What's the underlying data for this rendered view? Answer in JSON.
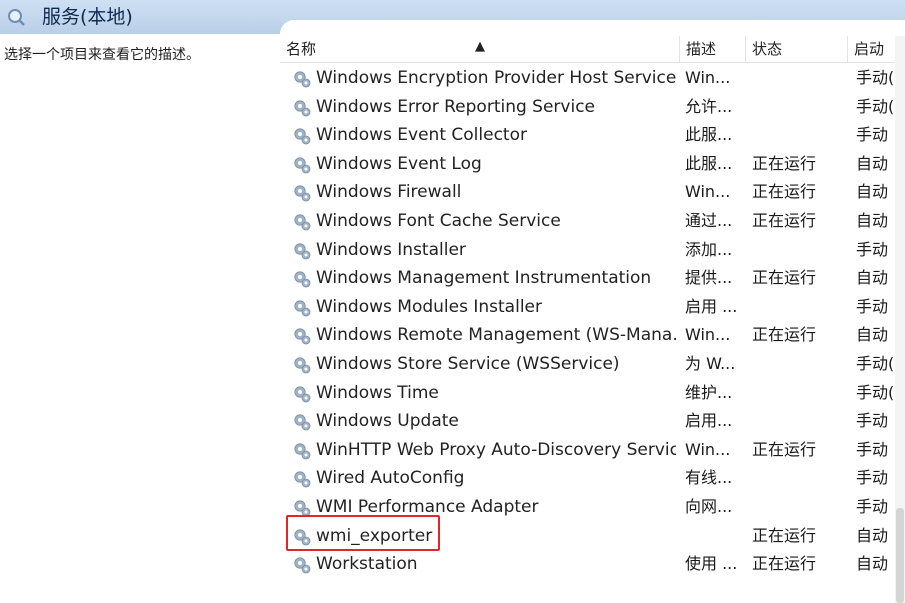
{
  "title": {
    "text": "服务(本地)",
    "icon": "magnifier-icon"
  },
  "left_pane": {
    "description": "选择一个项目来查看它的描述。"
  },
  "columns": {
    "name": "名称",
    "description": "描述",
    "status": "状态",
    "startup": "启动"
  },
  "services": [
    {
      "name": "Windows Encryption Provider Host Service",
      "desc": "Win...",
      "status": "",
      "startup": "手动("
    },
    {
      "name": "Windows Error Reporting Service",
      "desc": "允许...",
      "status": "",
      "startup": "手动("
    },
    {
      "name": "Windows Event Collector",
      "desc": "此服...",
      "status": "",
      "startup": "手动"
    },
    {
      "name": "Windows Event Log",
      "desc": "此服...",
      "status": "正在运行",
      "startup": "自动"
    },
    {
      "name": "Windows Firewall",
      "desc": "Win...",
      "status": "正在运行",
      "startup": "自动"
    },
    {
      "name": "Windows Font Cache Service",
      "desc": "通过...",
      "status": "正在运行",
      "startup": "自动"
    },
    {
      "name": "Windows Installer",
      "desc": "添加...",
      "status": "",
      "startup": "手动"
    },
    {
      "name": "Windows Management Instrumentation",
      "desc": "提供...",
      "status": "正在运行",
      "startup": "自动"
    },
    {
      "name": "Windows Modules Installer",
      "desc": "启用 ...",
      "status": "",
      "startup": "手动"
    },
    {
      "name": "Windows Remote Management (WS-Mana...",
      "desc": "Win...",
      "status": "正在运行",
      "startup": "自动"
    },
    {
      "name": "Windows Store Service (WSService)",
      "desc": "为 W...",
      "status": "",
      "startup": "手动("
    },
    {
      "name": "Windows Time",
      "desc": "维护...",
      "status": "",
      "startup": "手动("
    },
    {
      "name": "Windows Update",
      "desc": "启用...",
      "status": "",
      "startup": "手动"
    },
    {
      "name": "WinHTTP Web Proxy Auto-Discovery Service",
      "desc": "Win...",
      "status": "正在运行",
      "startup": "手动"
    },
    {
      "name": "Wired AutoConfig",
      "desc": "有线...",
      "status": "",
      "startup": "手动"
    },
    {
      "name": "WMI Performance Adapter",
      "desc": "向网...",
      "status": "",
      "startup": "手动"
    },
    {
      "name": "wmi_exporter",
      "desc": "",
      "status": "正在运行",
      "startup": "自动"
    },
    {
      "name": "Workstation",
      "desc": "使用 ...",
      "status": "正在运行",
      "startup": "自动"
    }
  ],
  "highlighted_service": "wmi_exporter",
  "colors": {
    "highlight_border": "#e0262a",
    "topbar": "#c4d8ef"
  }
}
